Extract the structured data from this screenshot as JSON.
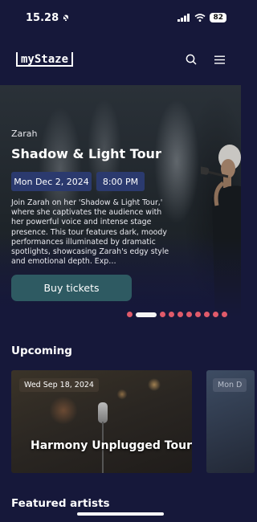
{
  "status_bar": {
    "time": "15.28",
    "battery": "82"
  },
  "header": {
    "logo": "myStaze"
  },
  "hero": {
    "artist": "Zarah",
    "title": "Shadow & Light Tour",
    "date": "Mon Dec 2, 2024",
    "time": "8:00 PM",
    "description": "Join Zarah on her 'Shadow & Light Tour,' where she captivates the audience with her powerful voice and intense stage presence. This tour features dark, moody performances illuminated by dramatic spotlights, showcasing Zarah's edgy style and emotional depth. Exp…",
    "buy_label": "Buy tickets",
    "carousel_total": 10,
    "carousel_active": 1
  },
  "upcoming": {
    "title": "Upcoming",
    "cards": [
      {
        "date": "Wed Sep 18, 2024",
        "title": "Harmony Unplugged Tour"
      },
      {
        "date": "Mon D"
      }
    ]
  },
  "featured": {
    "title": "Featured artists"
  },
  "colors": {
    "background": "#16183a",
    "accent": "#2e5a62",
    "pill": "#2b3a6e",
    "dot": "#e05a6a"
  }
}
